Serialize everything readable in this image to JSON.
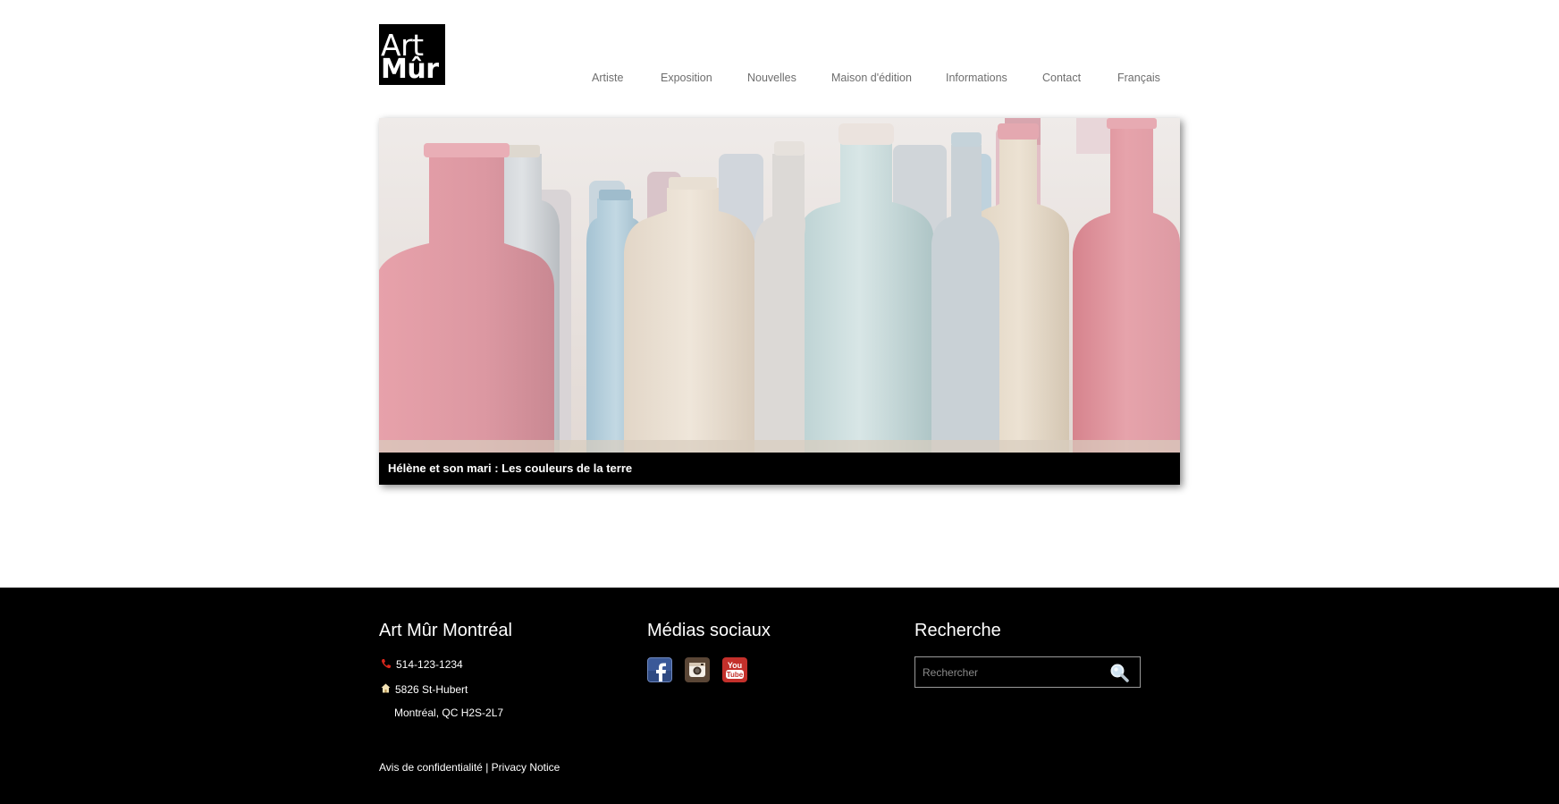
{
  "logo": {
    "line1": "Art",
    "line2": "Mûr"
  },
  "nav": {
    "items": [
      {
        "label": "Artiste"
      },
      {
        "label": "Exposition"
      },
      {
        "label": "Nouvelles"
      },
      {
        "label": "Maison d'édition"
      },
      {
        "label": "Informations"
      },
      {
        "label": "Contact"
      },
      {
        "label": "Français"
      }
    ]
  },
  "slider": {
    "caption": "Hélène et son mari : Les couleurs de la terre"
  },
  "footer": {
    "contact": {
      "heading": "Art Mûr Montréal",
      "phone": "514-123-1234",
      "address_line1": "5826 St-Hubert",
      "address_line2": "Montréal, QC H2S-2L7",
      "phone_icon": "phone-icon",
      "address_icon": "home-icon"
    },
    "social": {
      "heading": "Médias sociaux",
      "icons": [
        "facebook-icon",
        "instagram-icon",
        "youtube-icon"
      ],
      "youtube_text_1": "You",
      "youtube_text_2": "Tube"
    },
    "search": {
      "heading": "Recherche",
      "placeholder": "Rechercher",
      "icon": "search-icon"
    },
    "links": {
      "privacy_fr": "Avis de confidentialité",
      "separator": "|",
      "privacy_en": "Privacy Notice"
    }
  },
  "colors": {
    "footer_bg": "#000000",
    "nav_text": "#6e6e6e",
    "phone_icon": "#d9261c",
    "facebook": "#3b5998",
    "instagram": "#5a4636",
    "youtube": "#c4302b"
  }
}
